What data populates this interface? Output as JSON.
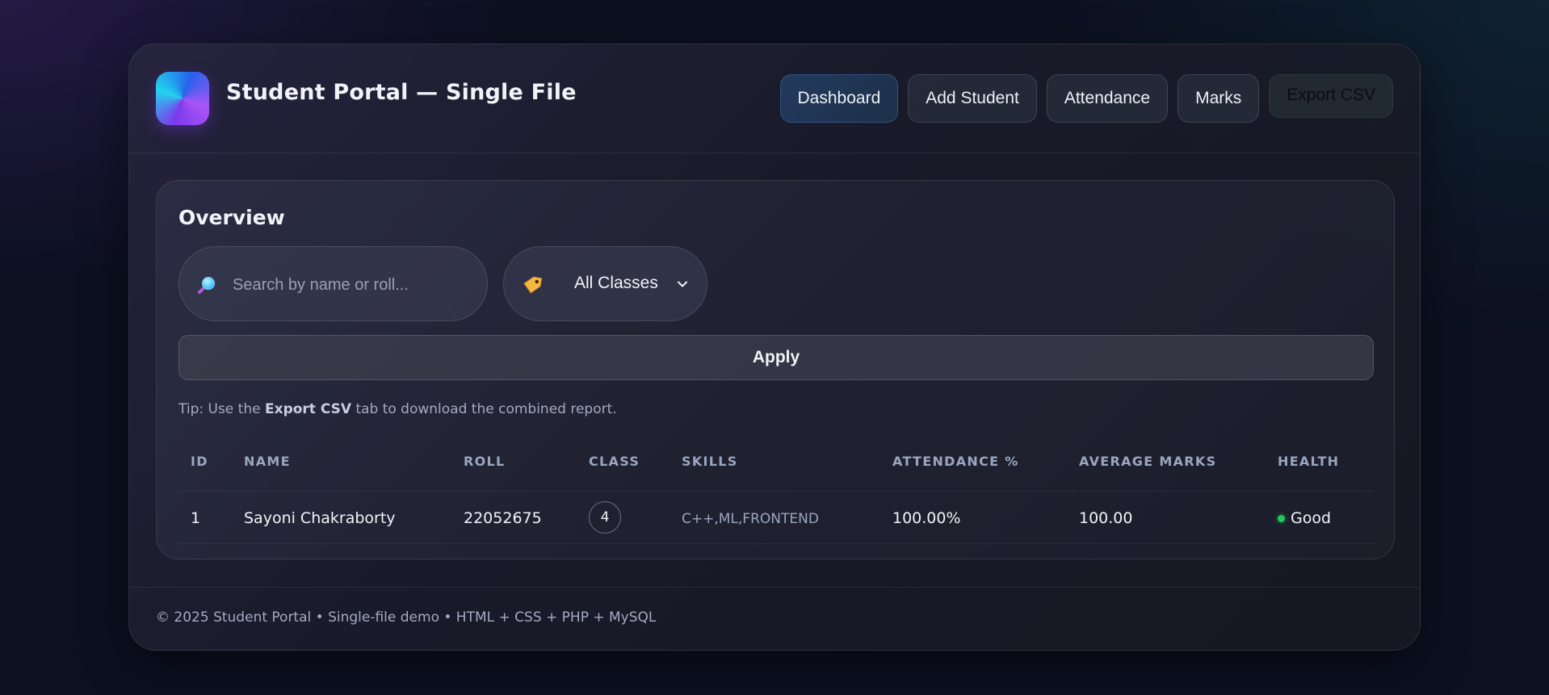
{
  "header": {
    "title": "Student Portal — Single File",
    "nav": [
      {
        "label": "Dashboard",
        "active": true
      },
      {
        "label": "Add Student",
        "active": false
      },
      {
        "label": "Attendance",
        "active": false
      },
      {
        "label": "Marks",
        "active": false
      },
      {
        "label": "Export CSV",
        "active": false
      }
    ]
  },
  "overview": {
    "title": "Overview",
    "search": {
      "placeholder": "Search by name or roll...",
      "value": "",
      "icon": "magnifier-icon"
    },
    "class_filter": {
      "selected": "All Classes",
      "icon": "tag-icon"
    },
    "apply_label": "Apply",
    "tip": {
      "prefix": "Tip: Use the",
      "highlight": "Export CSV",
      "suffix": "tab to download the combined report."
    }
  },
  "table": {
    "columns": [
      "ID",
      "NAME",
      "ROLL",
      "CLASS",
      "SKILLS",
      "ATTENDANCE %",
      "AVERAGE MARKS",
      "HEALTH"
    ],
    "rows": [
      {
        "id": "1",
        "name": "Sayoni Chakraborty",
        "roll": "22052675",
        "class": "4",
        "skills": "C++,ML,FRONTEND",
        "attendance": "100.00%",
        "average_marks": "100.00",
        "health": "Good",
        "health_color": "#22c55e"
      }
    ]
  },
  "footer": {
    "text": "© 2025 Student Portal • Single-file demo • HTML + CSS + PHP + MySQL"
  },
  "colors": {
    "background": "#0c1020",
    "accent": "#7c3aed",
    "active_nav": "#233a5e",
    "good": "#22c55e"
  }
}
